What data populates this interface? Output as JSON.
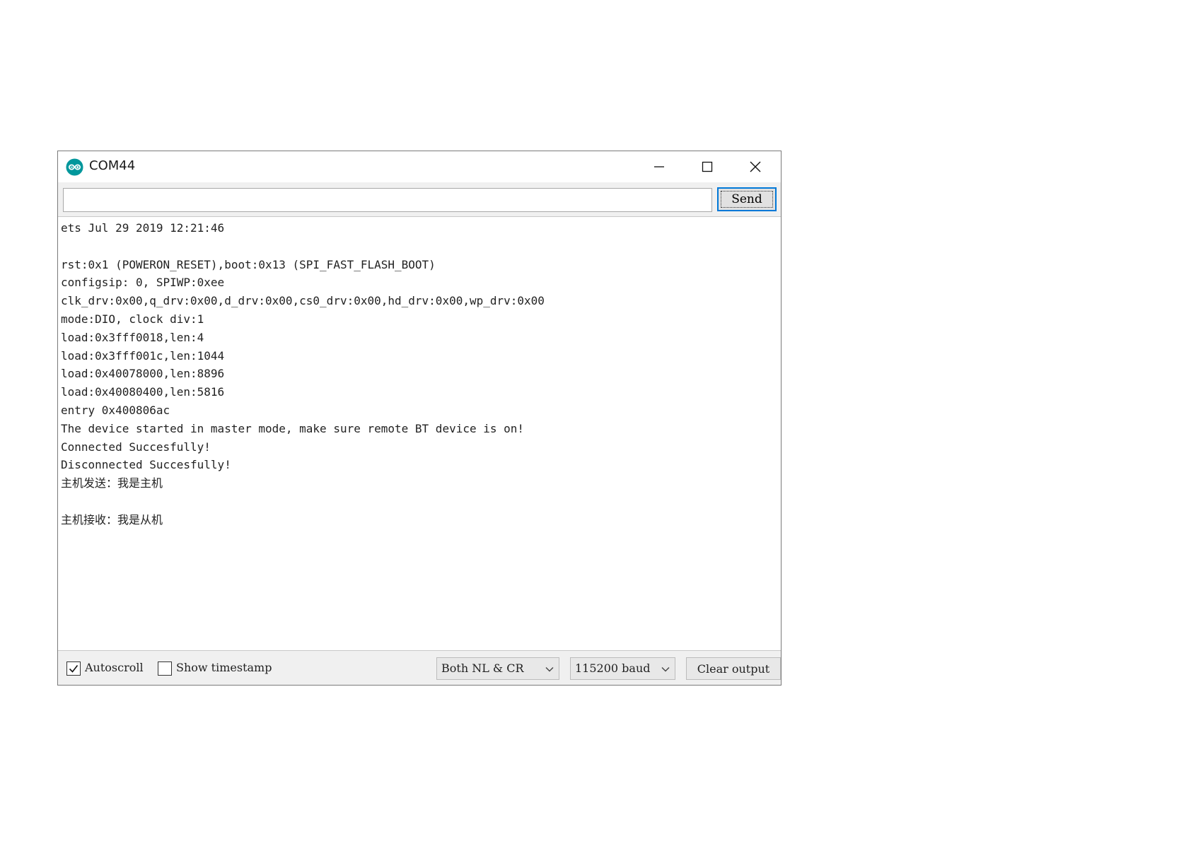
{
  "window": {
    "title": "COM44",
    "icon": "arduino-icon"
  },
  "send_bar": {
    "input_value": "",
    "send_label": "Send"
  },
  "output": {
    "lines": [
      "ets Jul 29 2019 12:21:46",
      "",
      "rst:0x1 (POWERON_RESET),boot:0x13 (SPI_FAST_FLASH_BOOT)",
      "configsip: 0, SPIWP:0xee",
      "clk_drv:0x00,q_drv:0x00,d_drv:0x00,cs0_drv:0x00,hd_drv:0x00,wp_drv:0x00",
      "mode:DIO, clock div:1",
      "load:0x3fff0018,len:4",
      "load:0x3fff001c,len:1044",
      "load:0x40078000,len:8896",
      "load:0x40080400,len:5816",
      "entry 0x400806ac",
      "The device started in master mode, make sure remote BT device is on!",
      "Connected Succesfully!",
      "Disconnected Succesfully!",
      "主机发送：我是主机",
      "",
      "主机接收：我是从机"
    ]
  },
  "status_bar": {
    "autoscroll_label": "Autoscroll",
    "autoscroll_checked": true,
    "timestamp_label": "Show timestamp",
    "timestamp_checked": false,
    "line_ending": "Both NL & CR",
    "baud": "115200 baud",
    "clear_label": "Clear output"
  },
  "colors": {
    "accent": "#0078d7",
    "arduino_teal": "#00979c"
  }
}
